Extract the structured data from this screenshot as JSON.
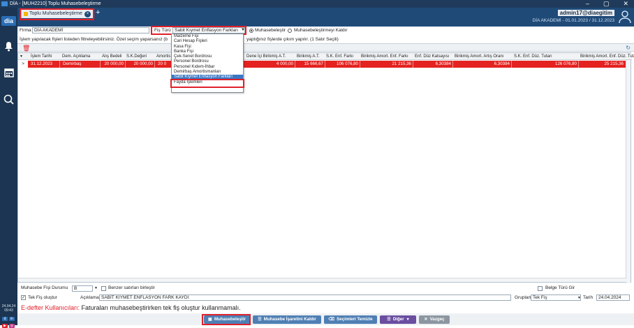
{
  "window": {
    "title": "DİA - [MUH2210] Toplu Muhasebeleştirme",
    "minimize": "–",
    "maximize": "▢",
    "close": "✕"
  },
  "sidebar": {
    "logo": "dia",
    "time": "24.04.24",
    "time2": "09:43"
  },
  "tabs": {
    "active": "Toplu Muhasebeleştirme",
    "close": "×",
    "add": "+"
  },
  "user": {
    "name": "admin17@diaegitim",
    "company": "DİA AKADEMİ - 01.01.2023 / 31.12.2023"
  },
  "filter": {
    "firma_label": "Firma",
    "firma_value": "DİA AKADEMİ",
    "fis_turu_label": "Fiş Türü",
    "fis_turu_value": "Sabit Kıymet Enflasyon Farkları",
    "radio1": "Muhasebeleştir",
    "radio2": "Muhasebeleştirmeyi Kaldır"
  },
  "info": {
    "left": "İşlem yapılacak fişleri listeden filtreleyebilirsiniz. Özel seçim yaparsanız (b",
    "right": "yaptığınız fişlerde çıkım yapılır. (1 Satır Seçili)"
  },
  "dropdown": {
    "items": [
      "Malzeme Fişi",
      "Cari Hesap Fişleri",
      "Kasa Fişi",
      "Banka Fişi",
      "Çek-Senet Bordrosu",
      "Personel Bordrosu",
      "Personel Kıdem-İhbar",
      "Demirbaş Amortismanları",
      "Sabit Kıymet Enflasyon Farkları",
      "Fayda İşlemleri"
    ],
    "selected_index": 8
  },
  "grid": {
    "headers_left": [
      "İşlem Tarihi",
      "Dem. Açıklama",
      "Alış Bedeli",
      "S.K.Değeri",
      "Amortis"
    ],
    "headers_right": [
      "Dene İçi Birikmiş A.T.",
      "Birikmiş A.T.",
      "S.K. Enf. Farkı",
      "Birikmiş Amort. Enf. Farkı",
      "Enf. Düz Katsayısı",
      "Birikmiş Amort. Artış Oranı",
      "S.K. Enf. Düz. Tutarı",
      "Birikmiş Amort. Enf. Düz. Tutarı"
    ],
    "row": {
      "marker": ">",
      "tarih": "31.12.2023",
      "aciklama": "Demirbaş",
      "alis": "20 000,00",
      "deger": "20 000,00",
      "amort": "20 0",
      "d1": "4 000,00",
      "d2": "15 666,67",
      "d3": "106 076,80",
      "d4": "21 215,36",
      "d5": "6,30384",
      "d6": "6,30384",
      "d7": "126 076,80",
      "d8": "25 215,36"
    }
  },
  "bottom": {
    "fis_durumu_label": "Muhasebe Fişi Durumu",
    "fis_durumu_value": "B",
    "benzer_label": "Benzer satırları birleştir",
    "belge_label": "Belge Türü Gir",
    "tek_fis_label": "Tek Fiş oluştur",
    "aciklama_label": "Açıklama",
    "aciklama_value": "SABİT KIYMET ENFLASYON FARK KAYDI",
    "gruplama_label": "Gruplama",
    "gruplama_value": "Tek Fiş",
    "tarih_label": "Tarih",
    "tarih_value": "24.04.2024"
  },
  "edefter": {
    "label": "E-defter Kullanıcıları:",
    "text": " Faturaları muhasebeştirirken tek fiş oluştur kullanmamalı."
  },
  "buttons": {
    "muhasebelestir": "Muhasebeleştir",
    "isaret_kaldir": "Muhasebe İşaretini Kaldır",
    "secimleri_temizle": "Seçimleri Temizle",
    "diger": "Diğer",
    "vazgec": "Vazgeç"
  },
  "colors": {
    "accent": "#1f4a78",
    "highlight_row": "#e42220",
    "frame": "#e0202a",
    "btn_blue": "#4f7fb4",
    "btn_purple": "#6a4ea0",
    "btn_gray": "#8c96a0"
  }
}
